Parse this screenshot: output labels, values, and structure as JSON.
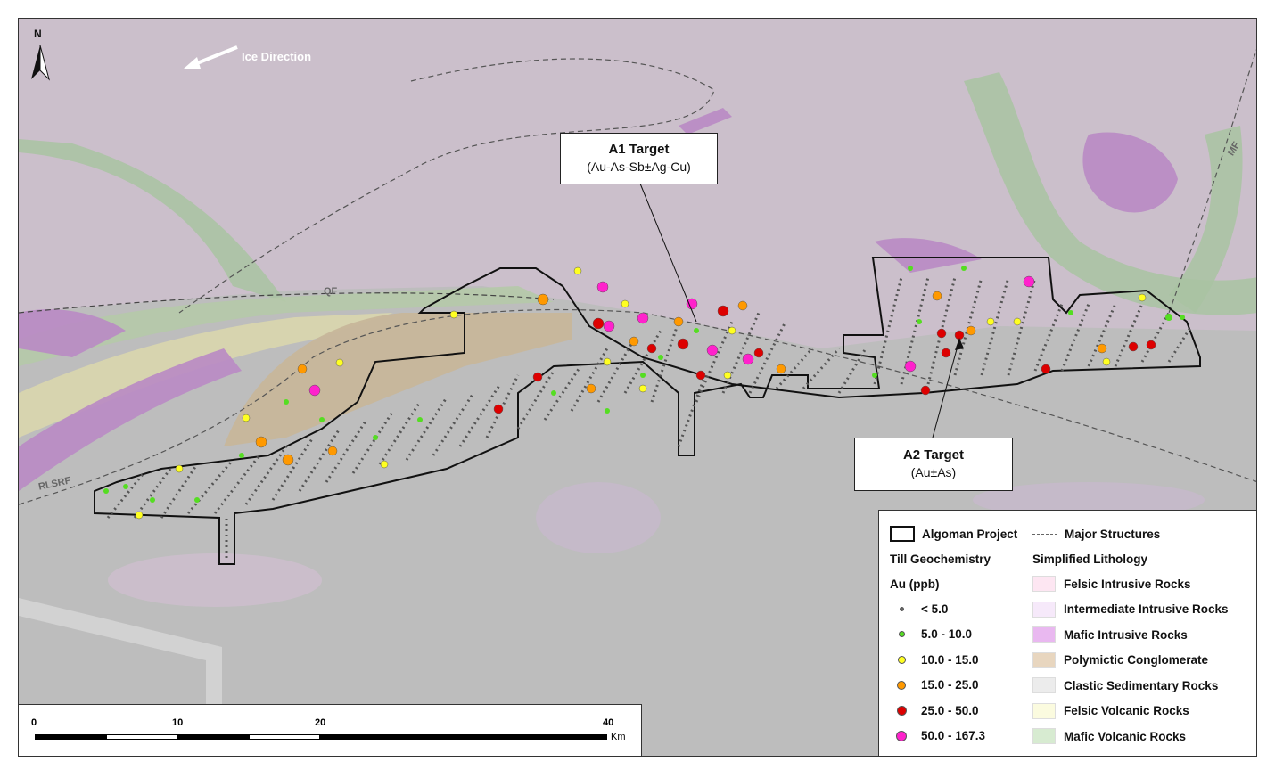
{
  "map": {
    "north_label": "N",
    "ice_direction_label": "Ice Direction",
    "structure_labels": {
      "qf": "QF",
      "rlsrf": "RLSRF",
      "mf": "MF"
    }
  },
  "callouts": {
    "a1": {
      "title": "A1 Target",
      "subtitle": "(Au-As-Sb±Ag-Cu)"
    },
    "a2": {
      "title": "A2 Target",
      "subtitle": "(Au±As)"
    }
  },
  "legend": {
    "project_label": "Algoman Project",
    "structures_label": "Major Structures",
    "till_title": "Till Geochemistry",
    "au_title": "Au (ppb)",
    "lithology_title": "Simplified Lithology",
    "au_classes": [
      {
        "label": "< 5.0",
        "color": "#666666",
        "size": 5
      },
      {
        "label": "5.0 - 10.0",
        "color": "#55dd22",
        "size": 7
      },
      {
        "label": "10.0 - 15.0",
        "color": "#ffff22",
        "size": 9
      },
      {
        "label": "15.0 - 25.0",
        "color": "#ff9900",
        "size": 10
      },
      {
        "label": "25.0 - 50.0",
        "color": "#dd0000",
        "size": 11
      },
      {
        "label": "50.0 - 167.3",
        "color": "#ff22cc",
        "size": 12
      }
    ],
    "lithology": [
      {
        "label": "Felsic Intrusive Rocks",
        "color": "#fde6f2"
      },
      {
        "label": "Intermediate Intrusive Rocks",
        "color": "#f6e9fa"
      },
      {
        "label": "Mafic Intrusive Rocks",
        "color": "#e9b8f0"
      },
      {
        "label": "Polymictic Conglomerate",
        "color": "#e8d6bf"
      },
      {
        "label": "Clastic Sedimentary Rocks",
        "color": "#ececec"
      },
      {
        "label": "Felsic Volcanic Rocks",
        "color": "#fbfbdf"
      },
      {
        "label": "Mafic Volcanic Rocks",
        "color": "#d7ebd1"
      }
    ]
  },
  "scale_bar": {
    "labels": [
      "0",
      "10",
      "20",
      "40"
    ],
    "unit": "Km"
  }
}
